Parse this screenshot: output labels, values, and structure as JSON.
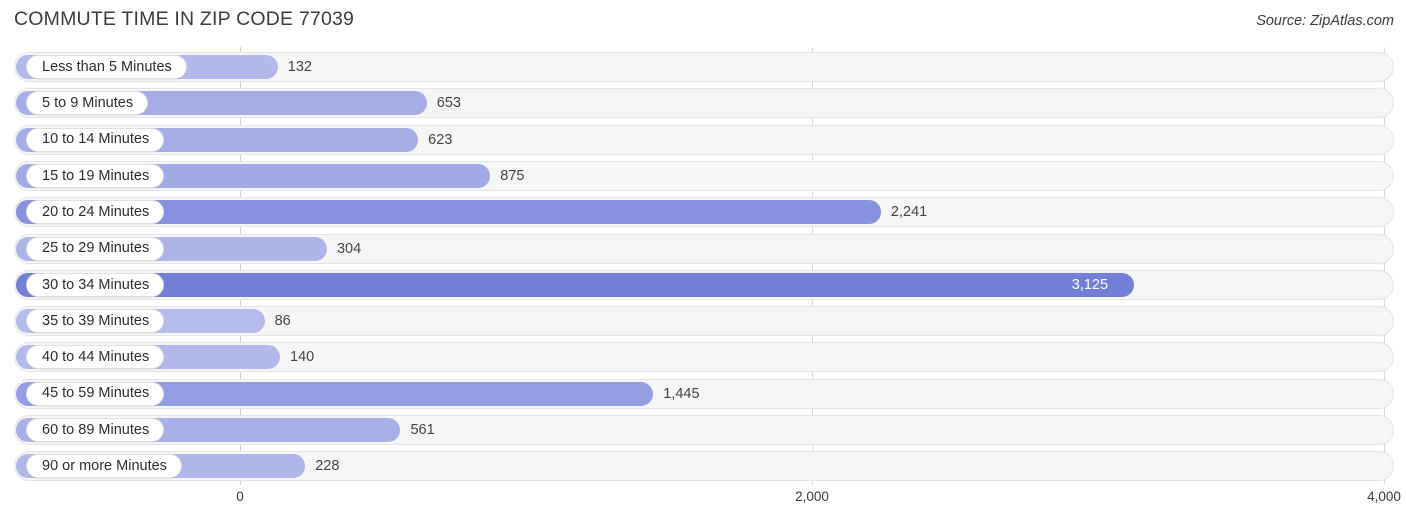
{
  "header": {
    "title": "COMMUTE TIME IN ZIP CODE 77039",
    "source": "Source: ZipAtlas.com"
  },
  "chart_data": {
    "type": "bar",
    "orientation": "horizontal",
    "title": "COMMUTE TIME IN ZIP CODE 77039",
    "subtitle": "",
    "xlabel": "",
    "ylabel": "",
    "xlim": [
      0,
      4000
    ],
    "grid": true,
    "legend": null,
    "source": "Source: ZipAtlas.com",
    "tick_labels": [
      "0",
      "2,000",
      "4,000"
    ],
    "tick_values": [
      0,
      2000,
      4000
    ],
    "categories": [
      "Less than 5 Minutes",
      "5 to 9 Minutes",
      "10 to 14 Minutes",
      "15 to 19 Minutes",
      "20 to 24 Minutes",
      "25 to 29 Minutes",
      "30 to 34 Minutes",
      "35 to 39 Minutes",
      "40 to 44 Minutes",
      "45 to 59 Minutes",
      "60 to 89 Minutes",
      "90 or more Minutes"
    ],
    "values": [
      132,
      653,
      623,
      875,
      2241,
      304,
      3125,
      86,
      140,
      1445,
      561,
      228
    ],
    "value_labels": [
      "132",
      "653",
      "623",
      "875",
      "2,241",
      "304",
      "3,125",
      "86",
      "140",
      "1,445",
      "561",
      "228"
    ],
    "bars": [
      {
        "label": "Less than 5 Minutes",
        "value": 132,
        "value_label": "132",
        "color": "#b3b9ea",
        "label_inside": false
      },
      {
        "label": "5 to 9 Minutes",
        "value": 653,
        "value_label": "653",
        "color": "#a7aee7",
        "label_inside": false
      },
      {
        "label": "10 to 14 Minutes",
        "value": 623,
        "value_label": "623",
        "color": "#a7aee7",
        "label_inside": false
      },
      {
        "label": "15 to 19 Minutes",
        "value": 875,
        "value_label": "875",
        "color": "#a2aae6",
        "label_inside": false
      },
      {
        "label": "20 to 24 Minutes",
        "value": 2241,
        "value_label": "2,241",
        "color": "#8791df",
        "label_inside": false
      },
      {
        "label": "25 to 29 Minutes",
        "value": 304,
        "value_label": "304",
        "color": "#aeb4e8",
        "label_inside": false
      },
      {
        "label": "30 to 34 Minutes",
        "value": 3125,
        "value_label": "3,125",
        "color": "#7480d8",
        "label_inside": true
      },
      {
        "label": "35 to 39 Minutes",
        "value": 86,
        "value_label": "86",
        "color": "#b5bbeb",
        "label_inside": false
      },
      {
        "label": "40 to 44 Minutes",
        "value": 140,
        "value_label": "140",
        "color": "#b3b9ea",
        "label_inside": false
      },
      {
        "label": "45 to 59 Minutes",
        "value": 1445,
        "value_label": "1,445",
        "color": "#959ee3",
        "label_inside": false
      },
      {
        "label": "60 to 89 Minutes",
        "value": 561,
        "value_label": "561",
        "color": "#a9b0e7",
        "label_inside": false
      },
      {
        "label": "90 or more Minutes",
        "value": 228,
        "value_label": "228",
        "color": "#b0b6e9",
        "label_inside": false
      }
    ]
  },
  "colors": {
    "bar_default": "#8b93e0",
    "bar_max": "#7480d8",
    "track": "#f6f6f6",
    "track_border": "#e4e4e4",
    "gridline": "#d8d8d8",
    "text": "#3c3c3c",
    "value_inside_text": "#ffffff"
  }
}
